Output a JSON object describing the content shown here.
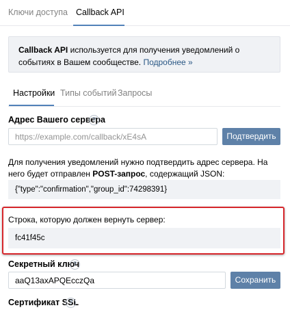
{
  "top_tabs": [
    "Ключи доступа",
    "Callback API"
  ],
  "info": {
    "bold": "Callback API",
    "text": "используется для получения уведомлений о событиях в Вашем сообществе.",
    "link": "Подробнее »"
  },
  "sub_tabs": [
    "Настройки",
    "Типы событий",
    "Запросы"
  ],
  "server": {
    "label": "Адрес Вашего сервера",
    "placeholder": "https://example.com/callback/xE4sA",
    "button": "Подтвердить"
  },
  "description": {
    "pre": "Для получения уведомлений нужно подтвердить адрес сервера. На него будет отправлен",
    "bold": "POST-запрос",
    "post": ", содержащий JSON:"
  },
  "json_payload": "{\"type\":\"confirmation\",\"group_id\":74298391}",
  "confirm_string": {
    "label": "Строка, которую должен вернуть сервер:",
    "value": "fc41f45c"
  },
  "secret": {
    "label": "Секретный ключ",
    "value": "aaQ13axAPQEcczQa",
    "button": "Сохранить"
  },
  "ssl": {
    "label": "Сертификат SSL"
  },
  "help_glyph": "?",
  "colors": {
    "accent": "#5181b8",
    "button": "#5e81a8",
    "highlight": "#d6262b",
    "panel": "#f0f2f5"
  }
}
